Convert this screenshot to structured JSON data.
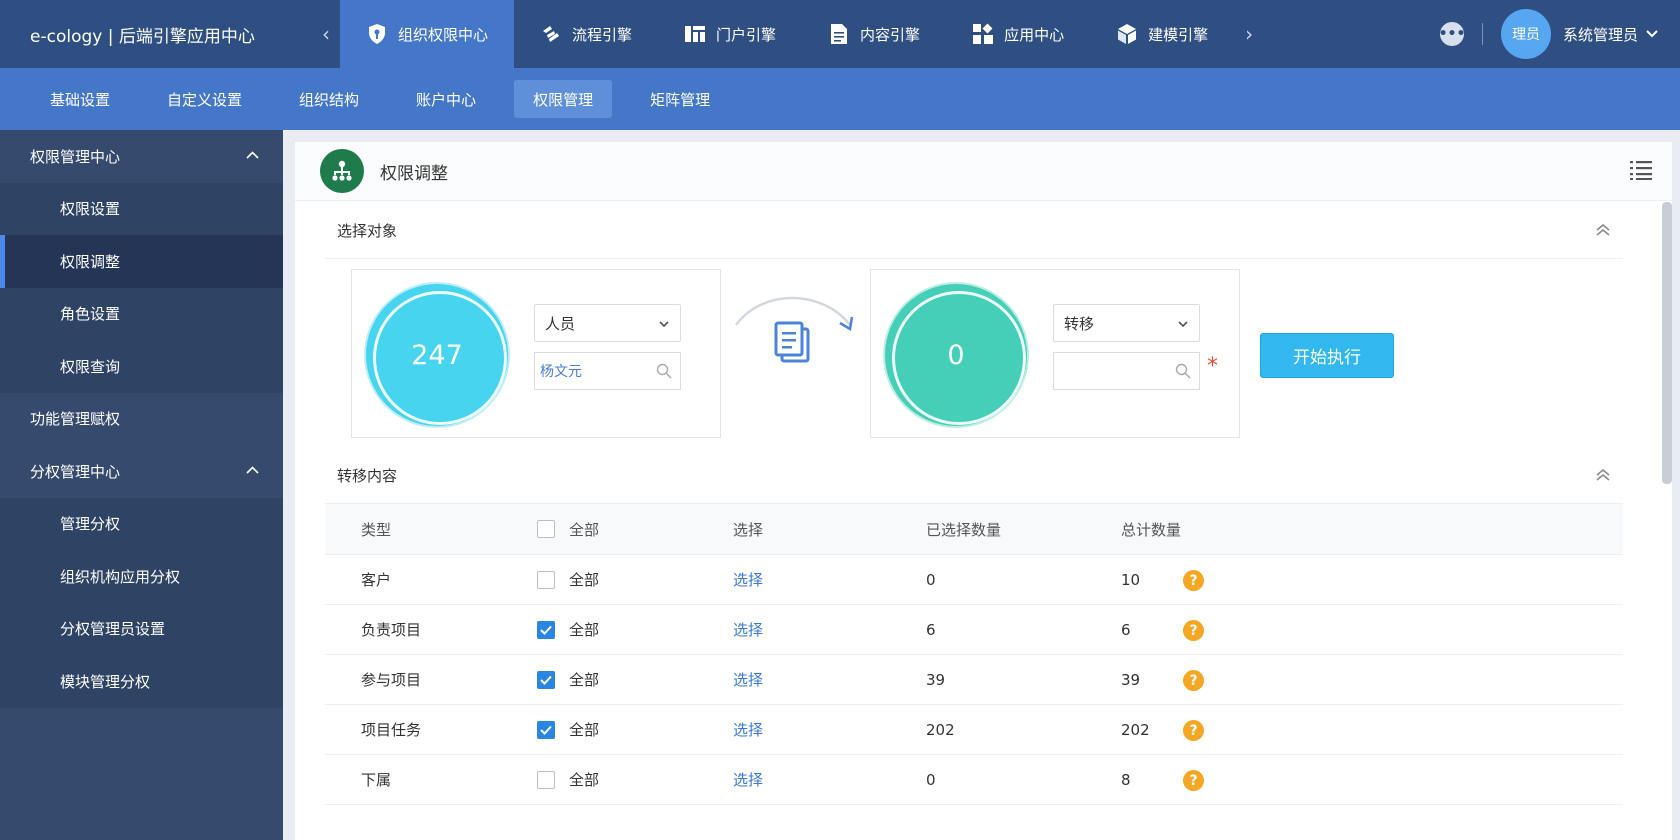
{
  "app": {
    "title": "e-cology | 后端引擎应用中心"
  },
  "topnav": {
    "tabs": [
      {
        "label": "组织权限中心",
        "icon": "shield-key-icon",
        "active": true
      },
      {
        "label": "流程引擎",
        "icon": "flow-icon",
        "active": false
      },
      {
        "label": "门户引擎",
        "icon": "portal-layout-icon",
        "active": false
      },
      {
        "label": "内容引擎",
        "icon": "document-icon",
        "active": false
      },
      {
        "label": "应用中心",
        "icon": "apps-grid-icon",
        "active": false
      },
      {
        "label": "建模引擎",
        "icon": "cube-icon",
        "active": false
      }
    ],
    "avatar_text": "理员",
    "username": "系统管理员"
  },
  "subnav": {
    "tabs": [
      {
        "label": "基础设置",
        "active": false
      },
      {
        "label": "自定义设置",
        "active": false
      },
      {
        "label": "组织结构",
        "active": false
      },
      {
        "label": "账户中心",
        "active": false
      },
      {
        "label": "权限管理",
        "active": true
      },
      {
        "label": "矩阵管理",
        "active": false
      }
    ]
  },
  "sidebar": {
    "items": [
      {
        "label": "权限管理中心",
        "type": "group",
        "expanded": true
      },
      {
        "label": "权限设置",
        "type": "child",
        "active": false
      },
      {
        "label": "权限调整",
        "type": "child",
        "active": true
      },
      {
        "label": "角色设置",
        "type": "child",
        "active": false
      },
      {
        "label": "权限查询",
        "type": "child",
        "active": false
      },
      {
        "label": "功能管理赋权",
        "type": "group",
        "expanded": false
      },
      {
        "label": "分权管理中心",
        "type": "group",
        "expanded": true
      },
      {
        "label": "管理分权",
        "type": "child",
        "active": false
      },
      {
        "label": "组织机构应用分权",
        "type": "child",
        "active": false
      },
      {
        "label": "分权管理员设置",
        "type": "child",
        "active": false
      },
      {
        "label": "模块管理分权",
        "type": "child",
        "active": false
      }
    ]
  },
  "page": {
    "title": "权限调整",
    "section1_title": "选择对象",
    "section2_title": "转移内容"
  },
  "source": {
    "count": "247",
    "type_value": "人员",
    "search_value": "杨文元"
  },
  "target": {
    "count": "0",
    "action_value": "转移",
    "search_value": "",
    "required_mark": "*"
  },
  "execute_button": "开始执行",
  "table": {
    "headers": {
      "type": "类型",
      "all": "全部",
      "select": "选择",
      "selected_count": "已选择数量",
      "total_count": "总计数量"
    },
    "rows": [
      {
        "type": "客户",
        "all_label": "全部",
        "checked": false,
        "select": "选择",
        "selected": "0",
        "total": "10"
      },
      {
        "type": "负责项目",
        "all_label": "全部",
        "checked": true,
        "select": "选择",
        "selected": "6",
        "total": "6"
      },
      {
        "type": "参与项目",
        "all_label": "全部",
        "checked": true,
        "select": "选择",
        "selected": "39",
        "total": "39"
      },
      {
        "type": "项目任务",
        "all_label": "全部",
        "checked": true,
        "select": "选择",
        "selected": "202",
        "total": "202"
      },
      {
        "type": "下属",
        "all_label": "全部",
        "checked": false,
        "select": "选择",
        "selected": "0",
        "total": "8"
      }
    ],
    "help_glyph": "?"
  },
  "colors": {
    "topbar": "#2f4f83",
    "accent": "#4577c9",
    "sidebar": "#354a6d",
    "button": "#32b7ef",
    "ring_source": "#46d4ee",
    "ring_target": "#45cfb8"
  }
}
